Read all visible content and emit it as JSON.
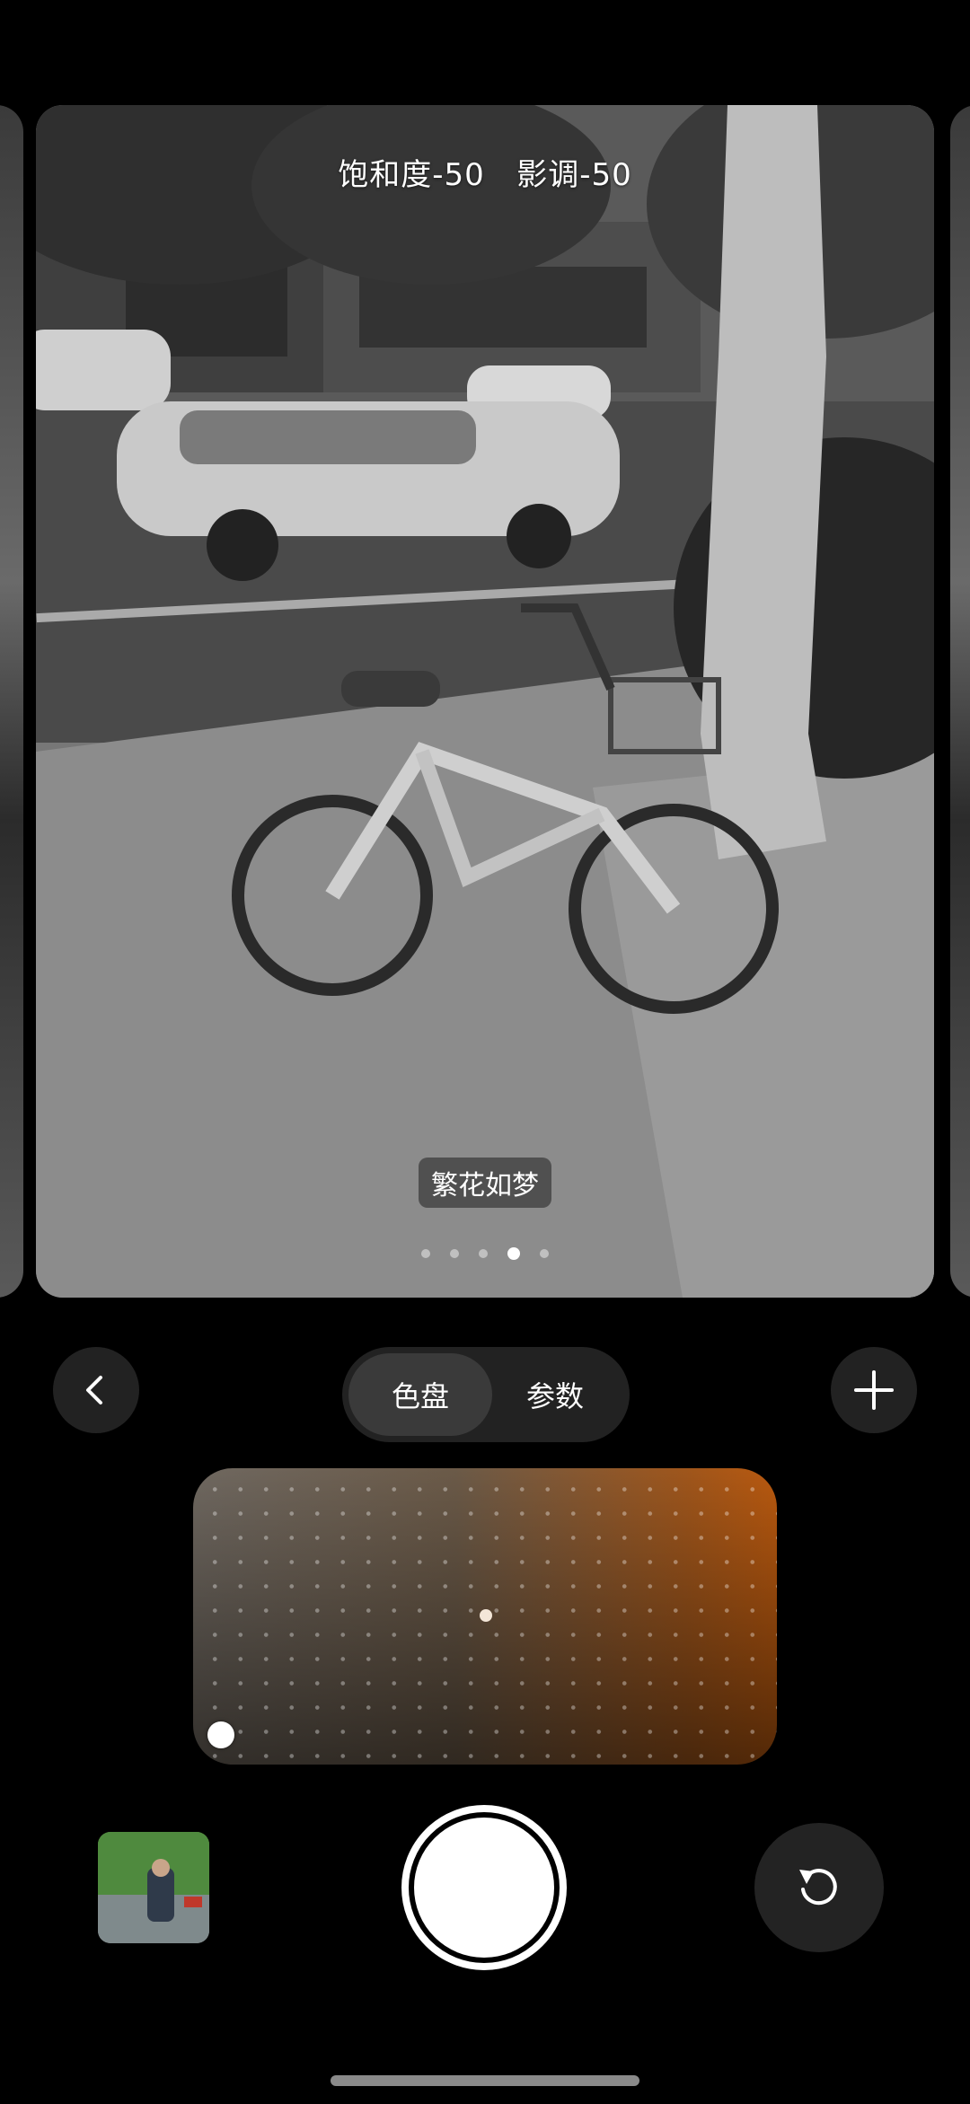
{
  "preview": {
    "adjustments": "饱和度-50   影调-50",
    "filter_name": "繁花如梦",
    "page_count": 5,
    "active_page": 3
  },
  "controls": {
    "back_icon": "chevron-left-icon",
    "add_icon": "plus-icon",
    "tabs": [
      {
        "label": "色盘",
        "active": true
      },
      {
        "label": "参数",
        "active": false
      }
    ]
  },
  "color_pad": {
    "accent_color": "#b9590f",
    "handle_position": "bottom-left"
  },
  "bottom_bar": {
    "gallery_icon": "gallery-thumbnail",
    "shutter_icon": "shutter-button",
    "reset_icon": "rotate-ccw-icon"
  }
}
